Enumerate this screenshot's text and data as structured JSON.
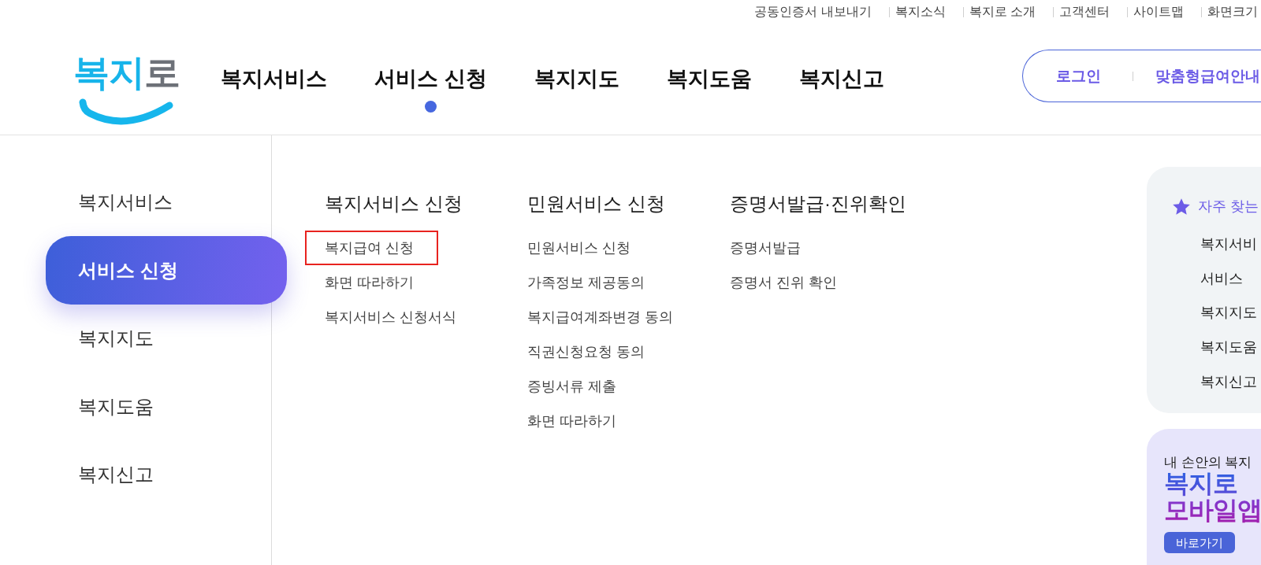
{
  "utility_links": [
    "공동인증서 내보내기",
    "복지소식",
    "복지로 소개",
    "고객센터",
    "사이트맵",
    "화면크기"
  ],
  "logo": {
    "text": "복지로"
  },
  "main_nav": [
    {
      "label": "복지서비스",
      "selected": false
    },
    {
      "label": "서비스 신청",
      "selected": true
    },
    {
      "label": "복지지도",
      "selected": false
    },
    {
      "label": "복지도움",
      "selected": false
    },
    {
      "label": "복지신고",
      "selected": false
    }
  ],
  "account_bar": {
    "links": [
      "로그인",
      "맞춤형급여안내"
    ]
  },
  "sidebar": {
    "items": [
      {
        "label": "복지서비스",
        "selected": false
      },
      {
        "label": "서비스 신청",
        "selected": true
      },
      {
        "label": "복지지도",
        "selected": false
      },
      {
        "label": "복지도움",
        "selected": false
      },
      {
        "label": "복지신고",
        "selected": false
      }
    ]
  },
  "submenu": {
    "columns": [
      {
        "heading": "복지서비스 신청",
        "items": [
          {
            "label": "복지급여 신청",
            "highlighted": true
          },
          {
            "label": "화면 따라하기",
            "highlighted": false
          },
          {
            "label": "복지서비스 신청서식",
            "highlighted": false
          }
        ]
      },
      {
        "heading": "민원서비스 신청",
        "items": [
          {
            "label": "민원서비스 신청",
            "highlighted": false
          },
          {
            "label": "가족정보 제공동의",
            "highlighted": false
          },
          {
            "label": "복지급여계좌변경 동의",
            "highlighted": false
          },
          {
            "label": "직권신청요청 동의",
            "highlighted": false
          },
          {
            "label": "증빙서류 제출",
            "highlighted": false
          },
          {
            "label": "화면 따라하기",
            "highlighted": false
          }
        ]
      },
      {
        "heading": "증명서발급·진위확인",
        "items": [
          {
            "label": "증명서발급",
            "highlighted": false
          },
          {
            "label": "증명서 진위 확인",
            "highlighted": false
          }
        ]
      }
    ]
  },
  "quick_links": {
    "title": "자주 찾는",
    "items": [
      "복지서비",
      "서비스",
      "복지지도",
      "복지도움",
      "복지신고"
    ]
  },
  "app_banner": {
    "tagline": "내 손안의 복지",
    "title_lines": [
      "복지로",
      "모바일앱"
    ],
    "button": "바로가기"
  }
}
